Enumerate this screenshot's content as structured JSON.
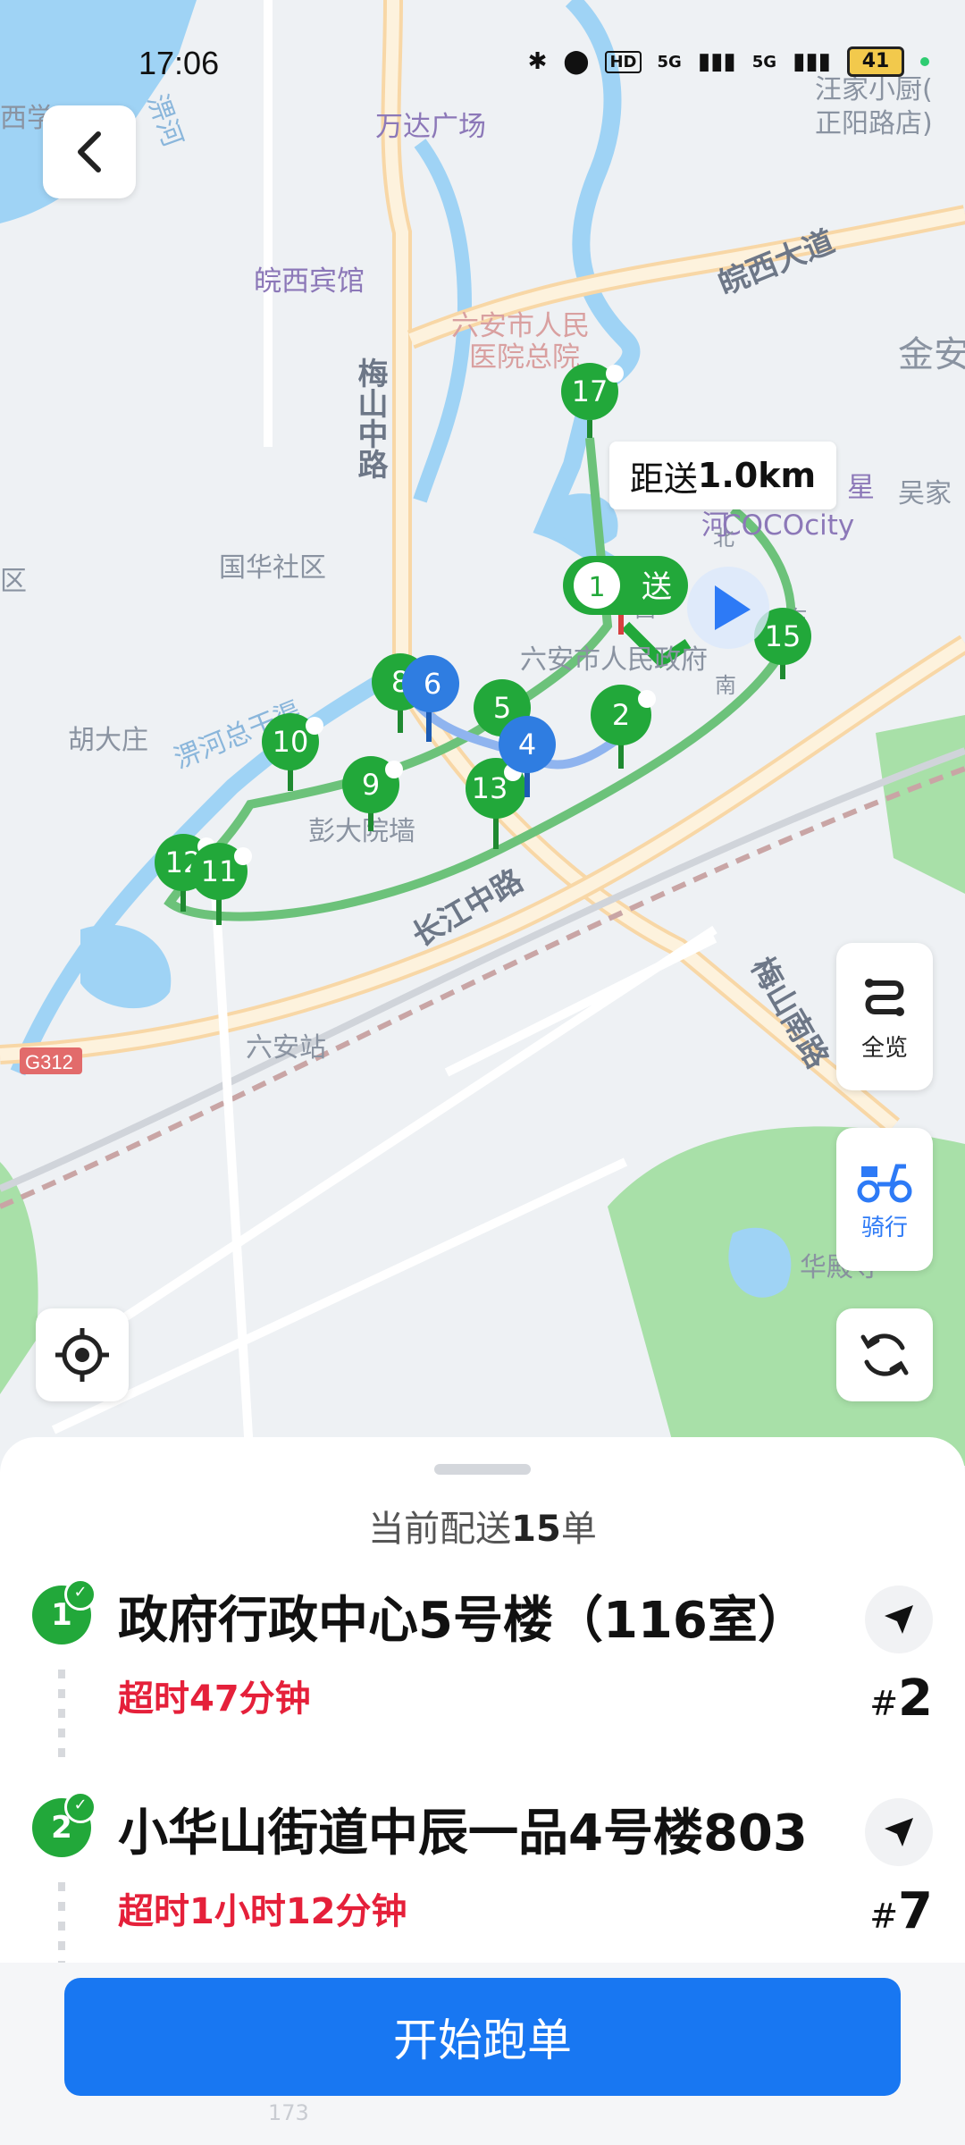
{
  "status_bar": {
    "time": "17:06",
    "network_1": "5G",
    "network_2": "5G",
    "hd": "HD",
    "battery": "41"
  },
  "map": {
    "places": {
      "wanda": "万达广场",
      "wanxi_hotel": "皖西宾馆",
      "hospital_l1": "六安市人民",
      "hospital_l2": "医院总院",
      "wangjia_l1": "汪家小厨(",
      "wangjia_l2": "正阳路店)",
      "guohua": "国华社区",
      "hudazhuang": "胡大庄",
      "pengda": "彭大院墙",
      "liuan_station": "六安站",
      "gov": "六安市人民政府",
      "cococity": "COCOcity",
      "xing": "星",
      "wujia": "吴家",
      "huadian": "华殿寺",
      "jin": "金安",
      "xiqu": "西学",
      "qu": "区",
      "xi": "西",
      "dong": "东",
      "nan": "南",
      "bei": "北",
      "he": "河"
    },
    "roads": {
      "wanxi_ave": "皖西大道",
      "meishan_mid": "梅山中路",
      "changjiang_mid": "长江中路",
      "meishan_south": "梅山南路",
      "pihe_canal": "淠河总干渠",
      "pihe": "淠河",
      "g312": "G312"
    },
    "pins_delivered": [
      "17",
      "1",
      "15",
      "2",
      "5",
      "8",
      "10",
      "9",
      "13",
      "12",
      "11"
    ],
    "pins_pending": [
      "6",
      "4"
    ],
    "send_pin_label": "送",
    "distance_prefix": "距送",
    "distance_value": "1.0km"
  },
  "controls": {
    "overview_label": "全览",
    "ride_label": "骑行"
  },
  "sheet": {
    "title_prefix": "当前配送",
    "title_count": "15",
    "title_suffix": "单",
    "orders": [
      {
        "index": "1",
        "address": "政府行政中心5号楼（116室）",
        "late": "超时47分钟",
        "hash": "#",
        "number": "2"
      },
      {
        "index": "2",
        "address": "小华山街道中辰一品4号楼803",
        "late": "超时1小时12分钟",
        "hash": "#",
        "number": "7"
      }
    ],
    "start_button": "开始跑单",
    "ghost_text": "173"
  },
  "colors": {
    "primary": "#1877f2",
    "delivered": "#22a83a",
    "pending": "#2f7de1",
    "late": "#e5203a"
  }
}
